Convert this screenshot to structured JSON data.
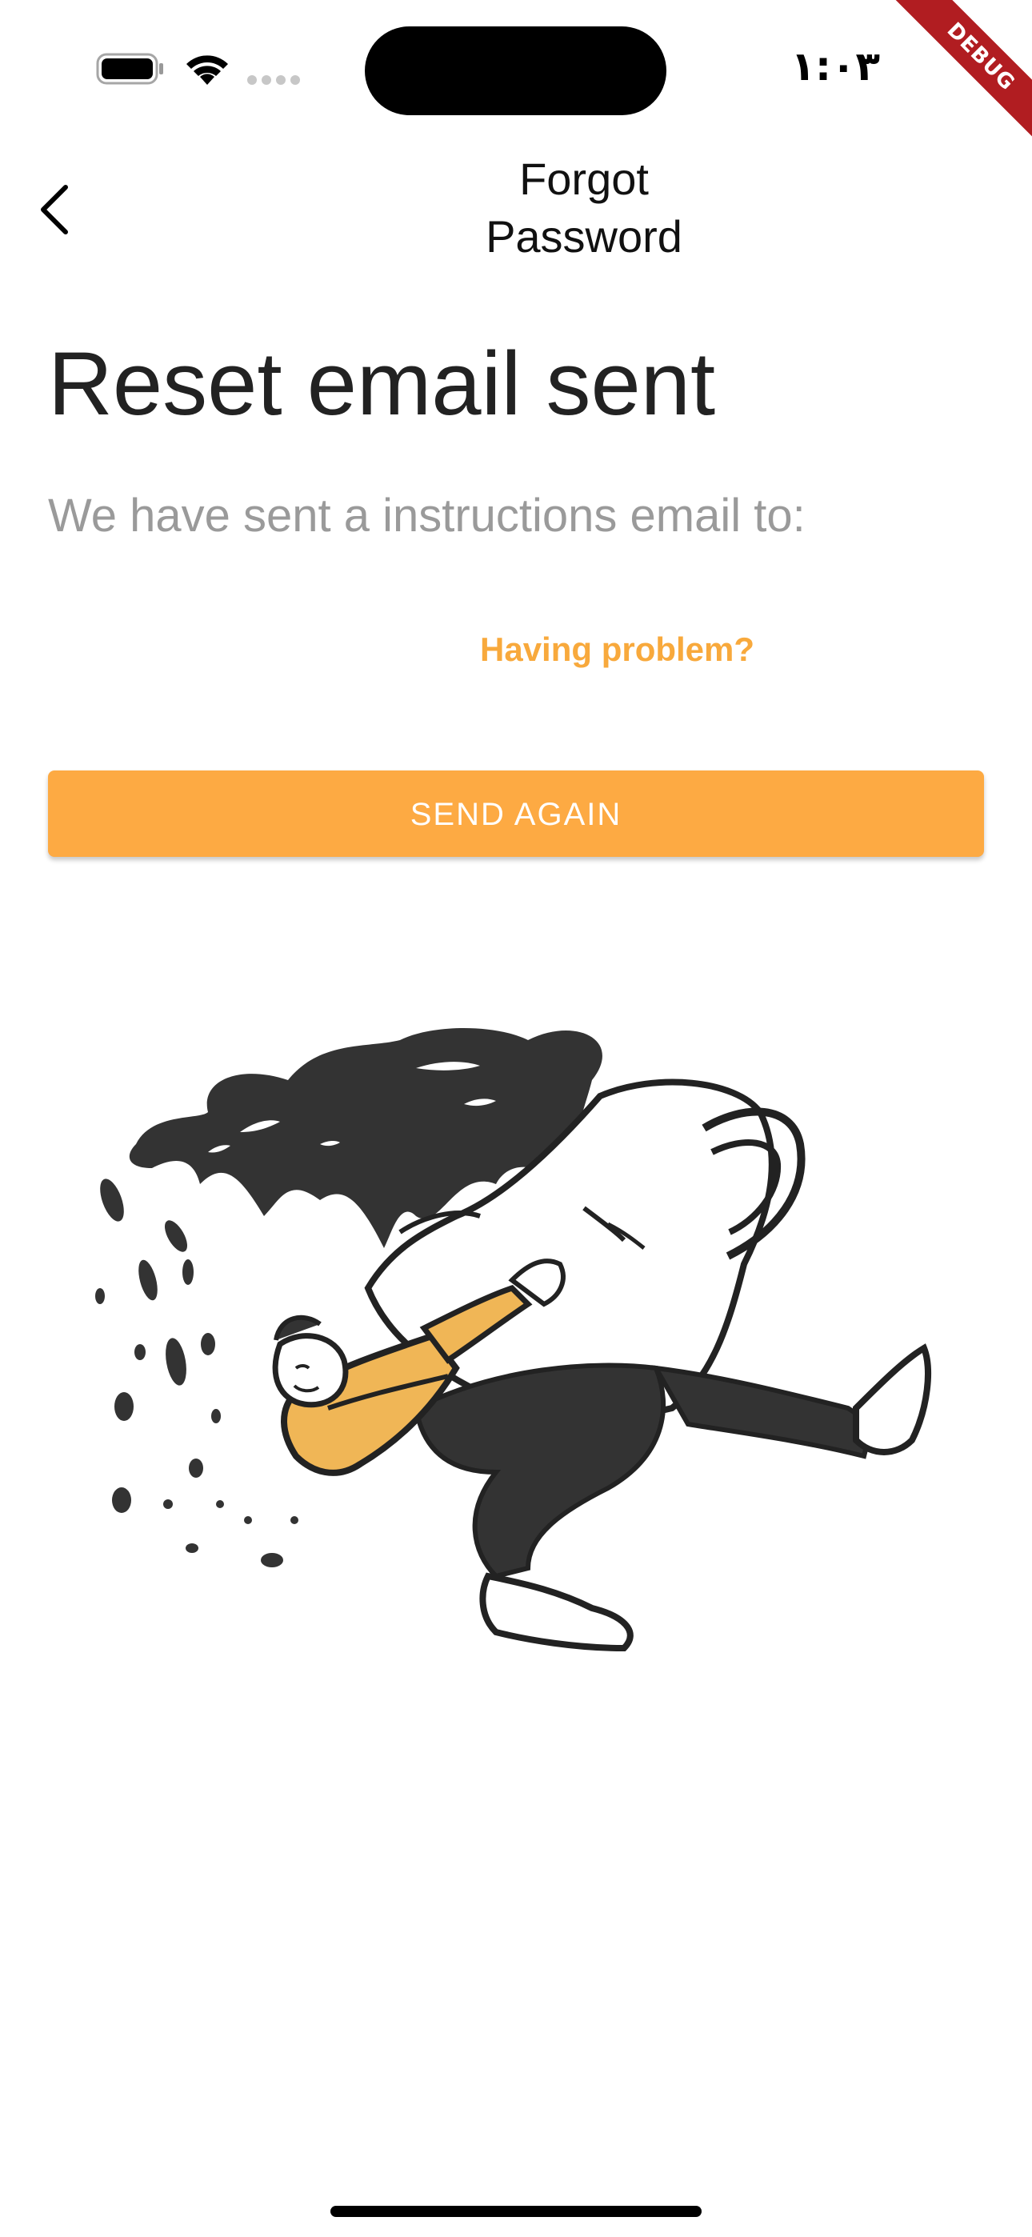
{
  "status_bar": {
    "time": "١:٠٣",
    "debug_label": "DEBUG",
    "icons": [
      "battery-icon",
      "wifi-icon",
      "cellular-signal-icon"
    ]
  },
  "app_bar": {
    "back_icon": "chevron-left-icon",
    "title": "Forgot Password"
  },
  "content": {
    "heading": "Reset email sent",
    "subheading": "We have sent a instructions email to:",
    "problem_link": "Having problem?",
    "send_again_label": "SEND AGAIN"
  },
  "illustration": {
    "name": "person-falling-with-coffee-cup-illustration"
  },
  "colors": {
    "accent": "#fdaa43",
    "link": "#f8a93c",
    "heading": "#222222",
    "subheading": "#9a9a9a",
    "debug_ribbon": "#b11d21",
    "illustration_dark": "#333333",
    "illustration_orange": "#f0b656"
  }
}
